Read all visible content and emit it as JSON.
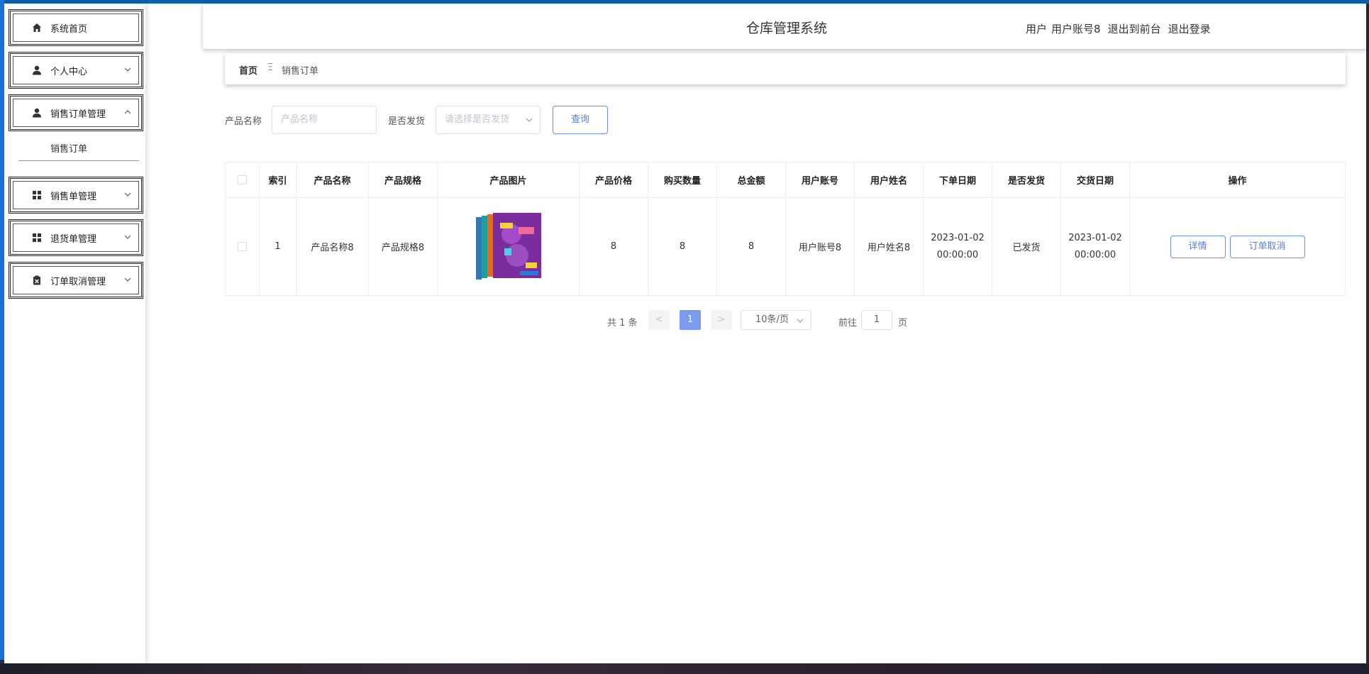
{
  "header": {
    "title": "仓库管理系统",
    "user_label": "用户",
    "user_account": "用户账号8",
    "back_to_front": "退出到前台",
    "logout": "退出登录"
  },
  "sidebar": {
    "items": [
      {
        "label": "系统首页",
        "icon": "home-icon"
      },
      {
        "label": "个人中心",
        "icon": "user-icon"
      },
      {
        "label": "销售订单管理",
        "icon": "user-icon"
      },
      {
        "label": "销售单管理",
        "icon": "grid-icon"
      },
      {
        "label": "退货单管理",
        "icon": "grid-icon"
      },
      {
        "label": "订单取消管理",
        "icon": "clipboard-icon"
      }
    ],
    "submenu": {
      "label": "销售订单"
    }
  },
  "breadcrumb": {
    "home": "首页",
    "separator": "Ξ",
    "current": "销售订单"
  },
  "search": {
    "product_name_label": "产品名称",
    "product_name_placeholder": "产品名称",
    "shipped_label": "是否发货",
    "shipped_placeholder": "请选择是否发货",
    "query_button": "查询"
  },
  "table": {
    "headers": [
      "索引",
      "产品名称",
      "产品规格",
      "产品图片",
      "产品价格",
      "购买数量",
      "总金额",
      "用户账号",
      "用户姓名",
      "下单日期",
      "是否发货",
      "交货日期",
      "操作"
    ],
    "rows": [
      {
        "index": "1",
        "product_name": "产品名称8",
        "product_spec": "产品规格8",
        "image": "book-cover-image",
        "price": "8",
        "quantity": "8",
        "total": "8",
        "user_account": "用户账号8",
        "user_name": "用户姓名8",
        "order_date": "2023-01-02 00:00:00",
        "shipped": "已发货",
        "delivery_date": "2023-01-02 00:00:00",
        "actions": {
          "detail": "详情",
          "cancel": "订单取消"
        }
      }
    ]
  },
  "pagination": {
    "total": "共 1 条",
    "prev": "<",
    "next": ">",
    "current_page": "1",
    "page_size": "10条/页",
    "goto_label": "前往",
    "goto_value": "1",
    "page_suffix": "页"
  },
  "colors": {
    "accent": "#5b7ed6",
    "active_page": "#7b9bf0"
  }
}
